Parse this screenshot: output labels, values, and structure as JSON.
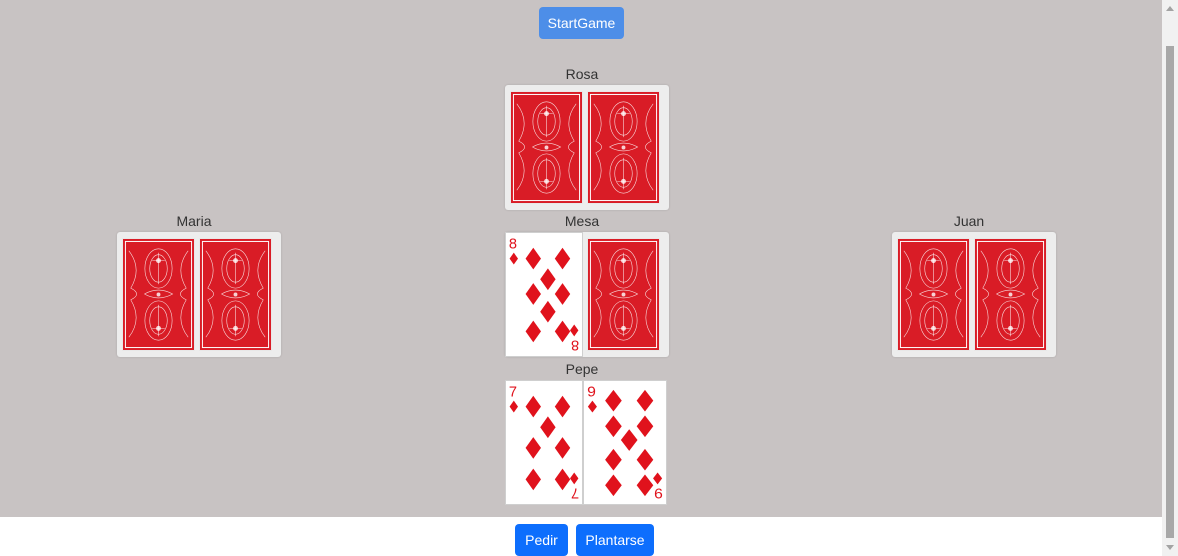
{
  "buttons": {
    "start": "StartGame",
    "pedir": "Pedir",
    "plantarse": "Plantarse"
  },
  "players": {
    "rosa": {
      "name": "Rosa",
      "cards": [
        "back",
        "back"
      ]
    },
    "maria": {
      "name": "Maria",
      "cards": [
        "back",
        "back"
      ]
    },
    "mesa": {
      "name": "Mesa",
      "cards": [
        {
          "rank": "8",
          "suit": "diamonds"
        },
        "back"
      ]
    },
    "juan": {
      "name": "Juan",
      "cards": [
        "back",
        "back"
      ]
    },
    "pepe": {
      "name": "Pepe",
      "cards": [
        {
          "rank": "7",
          "suit": "diamonds"
        },
        {
          "rank": "9",
          "suit": "diamonds"
        }
      ]
    }
  },
  "colors": {
    "table": "#c8c3c3",
    "card_back": "#d91c26",
    "suit_red": "#e0121c",
    "button_primary": "#0d6efd",
    "button_start": "#4d8ee8"
  }
}
